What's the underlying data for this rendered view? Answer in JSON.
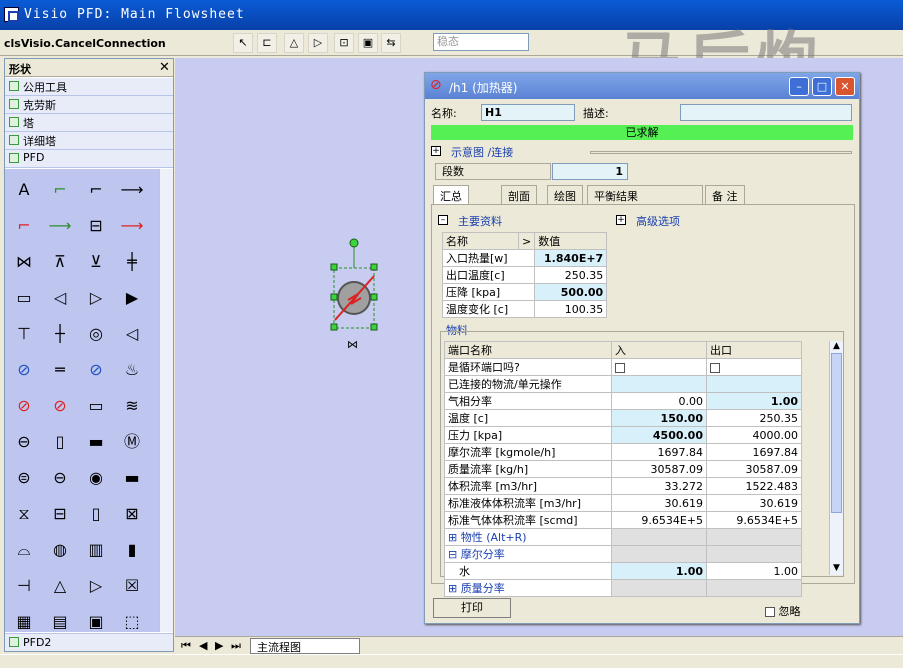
{
  "app": {
    "title": "Visio PFD: Main Flowsheet",
    "command_label": "clsVisio.CancelConnection",
    "status_placeholder": "稳态"
  },
  "watermark": "马后炮",
  "shapes_pane": {
    "title": "形状",
    "stencils": [
      "公用工具",
      "克劳斯",
      "塔",
      "详细塔",
      "PFD"
    ],
    "bottom_stencil": "PFD2"
  },
  "sheet_tab": "主流程图",
  "dialog": {
    "title": "/h1 (加热器)",
    "name_label": "名称:",
    "name_value": "H1",
    "desc_label": "描述:",
    "desc_value": "",
    "status": "已求解",
    "schematic_link": "示意图 /连接",
    "segments_label": "段数",
    "segments_value": "1",
    "tabs": [
      "汇总",
      "剖面",
      "绘图",
      "平衡结果",
      "备 注"
    ],
    "main_data_title": "主要资料",
    "advanced_title": "高级选项",
    "main_table": {
      "col1": "名称",
      "col2": "数值",
      "rows": [
        {
          "name": "入口热量[w]",
          "value": "1.840E+7",
          "hl": true
        },
        {
          "name": "出口温度[c]",
          "value": "250.35",
          "hl": false
        },
        {
          "name": "压降 [kpa]",
          "value": "500.00",
          "hl": true
        },
        {
          "name": "温度变化 [c]",
          "value": "100.35",
          "hl": false
        }
      ]
    },
    "material_title": "物料",
    "material_table": {
      "header": [
        "端口名称",
        "入",
        "出口"
      ],
      "rows": [
        {
          "name": "是循环端口吗?",
          "in": "",
          "out": "",
          "type": "check"
        },
        {
          "name": "已连接的物流/单元操作",
          "in": "",
          "out": "",
          "type": "blank"
        },
        {
          "name": "气相分率",
          "in": "0.00",
          "out": "1.00",
          "in_hl": false,
          "out_hl": true
        },
        {
          "name": "温度 [c]",
          "in": "150.00",
          "out": "250.35",
          "in_hl": true,
          "out_hl": false
        },
        {
          "name": "压力 [kpa]",
          "in": "4500.00",
          "out": "4000.00",
          "in_hl": true,
          "out_hl": false
        },
        {
          "name": "摩尔流率 [kgmole/h]",
          "in": "1697.84",
          "out": "1697.84"
        },
        {
          "name": "质量流率 [kg/h]",
          "in": "30587.09",
          "out": "30587.09"
        },
        {
          "name": "体积流率 [m3/hr]",
          "in": "33.272",
          "out": "1522.483"
        },
        {
          "name": "标准液体体积流率 [m3/hr]",
          "in": "30.619",
          "out": "30.619"
        },
        {
          "name": "标准气体体积流率 [scmd]",
          "in": "9.6534E+5",
          "out": "9.6534E+5"
        },
        {
          "name": "物性  (Alt+R)",
          "in": "",
          "out": "",
          "type": "group-plus"
        },
        {
          "name": "摩尔分率",
          "in": "",
          "out": "",
          "type": "group-minus"
        },
        {
          "name": "水",
          "in": "1.00",
          "out": "1.00",
          "in_hl": true,
          "out_hl": false
        },
        {
          "name": "质量分率",
          "in": "",
          "out": "",
          "type": "group-plus"
        }
      ]
    },
    "print_label": "打印",
    "ignore_label": "忽略"
  }
}
